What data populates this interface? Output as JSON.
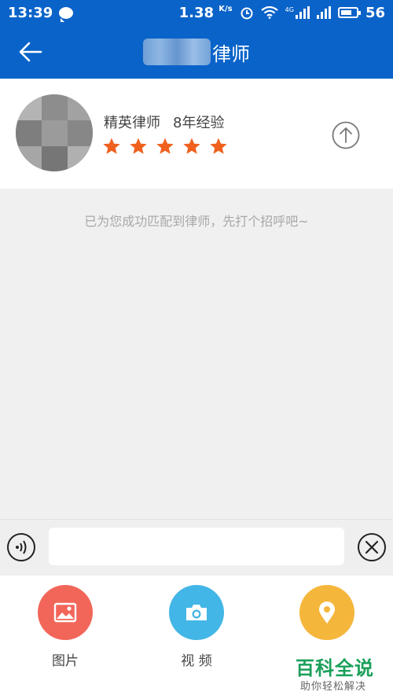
{
  "status_bar": {
    "time": "13:39",
    "net_speed": "1.38",
    "net_unit": "K/s",
    "network_4g": "4G",
    "battery": "56"
  },
  "nav": {
    "title": "律师"
  },
  "lawyer": {
    "title": "精英律师",
    "experience": "8年经验",
    "rating": 5,
    "rating_max": 5,
    "star_color": "#f0611e"
  },
  "chat": {
    "hint": "已为您成功匹配到律师，先打个招呼吧~"
  },
  "input": {
    "placeholder": ""
  },
  "attachments": [
    {
      "label": "图片",
      "icon": "image-icon",
      "color": "#f2665a"
    },
    {
      "label": "视 频",
      "icon": "camera-icon",
      "color": "#42b6e6"
    },
    {
      "label": "",
      "icon": "location-icon",
      "color": "#f5b63c"
    }
  ],
  "watermark": {
    "brand": "百科全说",
    "tagline": "助你轻松解决"
  },
  "colors": {
    "primary": "#0a63c9",
    "background": "#f0f0f0"
  }
}
